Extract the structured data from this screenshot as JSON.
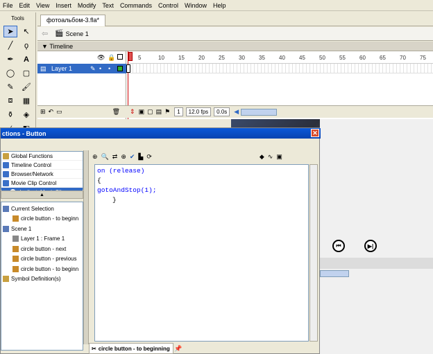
{
  "menu": [
    "File",
    "Edit",
    "View",
    "Insert",
    "Modify",
    "Text",
    "Commands",
    "Control",
    "Window",
    "Help"
  ],
  "tools": {
    "title": "Tools"
  },
  "document": {
    "tab": "фотоальбом-3.fla*",
    "scene": "Scene 1"
  },
  "timeline": {
    "title": "Timeline",
    "layer": "Layer 1",
    "ruler": [
      "5",
      "10",
      "15",
      "20",
      "25",
      "30",
      "35",
      "40",
      "45",
      "50",
      "55",
      "60",
      "65",
      "70",
      "75"
    ],
    "frame": "1",
    "fps": "12.0 fps",
    "time": "0.0s"
  },
  "actions_panel": {
    "title": "ctions - Button",
    "categories": [
      "Global Functions",
      "Timeline Control",
      "Browser/Network",
      "Movie Clip Control",
      "duplicateMovieClip"
    ],
    "tree": [
      "Current Selection",
      "circle button - to beginn",
      "Scene 1",
      "Layer 1 : Frame 1",
      "circle button - next",
      "circle button - previous",
      "circle button - to beginn",
      "Symbol Definition(s)"
    ],
    "code": [
      "on (release)",
      "{",
      "gotoAndStop(1);",
      "}"
    ],
    "bottom_tab": "circle button - to beginning"
  },
  "colors": {
    "selection": "#316ac5",
    "titlebar": "#0a58d8",
    "keyword": "#0000ff"
  }
}
